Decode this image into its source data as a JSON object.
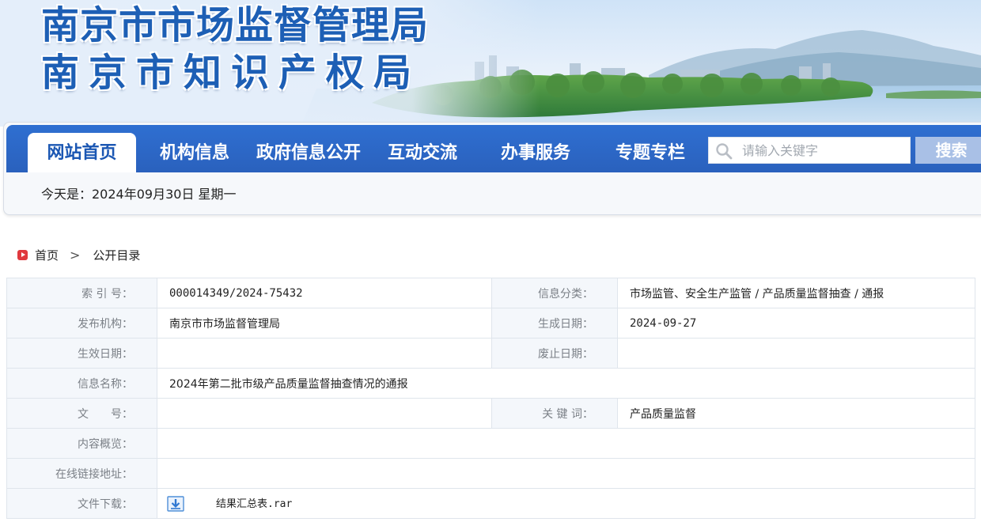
{
  "banner": {
    "title_line1": "南京市市场监督管理局",
    "title_line2": "南京市知识产权局"
  },
  "nav": {
    "items": [
      {
        "label": "网站首页",
        "active": true
      },
      {
        "label": "机构信息"
      },
      {
        "label": "政府信息公开"
      },
      {
        "label": "互动交流"
      },
      {
        "label": "办事服务"
      },
      {
        "label": "专题专栏"
      }
    ],
    "search_placeholder": "请输入关键字",
    "search_button": "搜索"
  },
  "date_line": "今天是：2024年09月30日 星期一",
  "breadcrumb": {
    "home": "首页",
    "separator": ">",
    "current": "公开目录"
  },
  "meta": {
    "index_label": "索 引 号：",
    "index_value": "000014349/2024-75432",
    "category_label": "信息分类：",
    "category_value": "市场监管、安全生产监管 / 产品质量监督抽查 / 通报",
    "publisher_label": "发布机构：",
    "publisher_value": "南京市市场监督管理局",
    "created_label": "生成日期：",
    "created_value": "2024-09-27",
    "effective_label": "生效日期：",
    "effective_value": "",
    "abolish_label": "废止日期：",
    "abolish_value": "",
    "name_label": "信息名称：",
    "name_value": "2024年第二批市级产品质量监督抽查情况的通报",
    "docno_label": "文　　号：",
    "docno_value": "",
    "keywords_label": "关 键 词：",
    "keywords_value": "产品质量监督",
    "summary_label": "内容概览：",
    "summary_value": "",
    "link_label": "在线链接地址：",
    "link_value": "",
    "download_label": "文件下载：",
    "download_file": "结果汇总表.rar"
  },
  "colors": {
    "nav_blue": "#2a64c5",
    "banner_title": "#1d5fb5",
    "search_button": "#a9c0e6",
    "label_bg": "#f4f7fb"
  }
}
